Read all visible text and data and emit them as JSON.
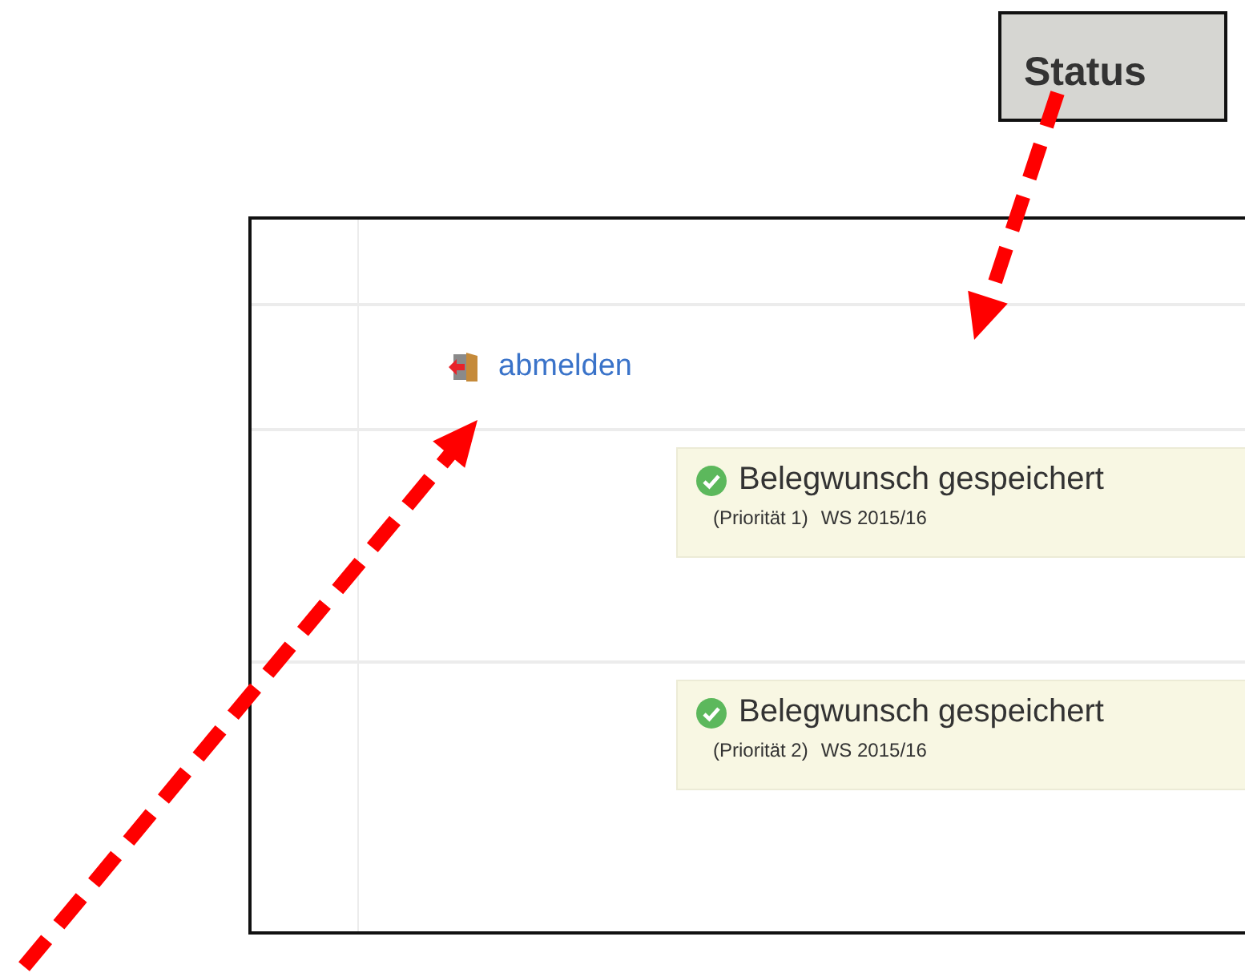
{
  "callout": {
    "text": "Status"
  },
  "table": {
    "rows": [
      {
        "kind": "action",
        "link": "abmelden"
      },
      {
        "kind": "status",
        "title": "Belegwunsch gespeichert",
        "priority": "(Priorität 1)",
        "term": "WS 2015/16"
      },
      {
        "kind": "status",
        "title": "Belegwunsch gespeichert",
        "priority": "(Priorität 2)",
        "term": "WS 2015/16"
      }
    ]
  }
}
